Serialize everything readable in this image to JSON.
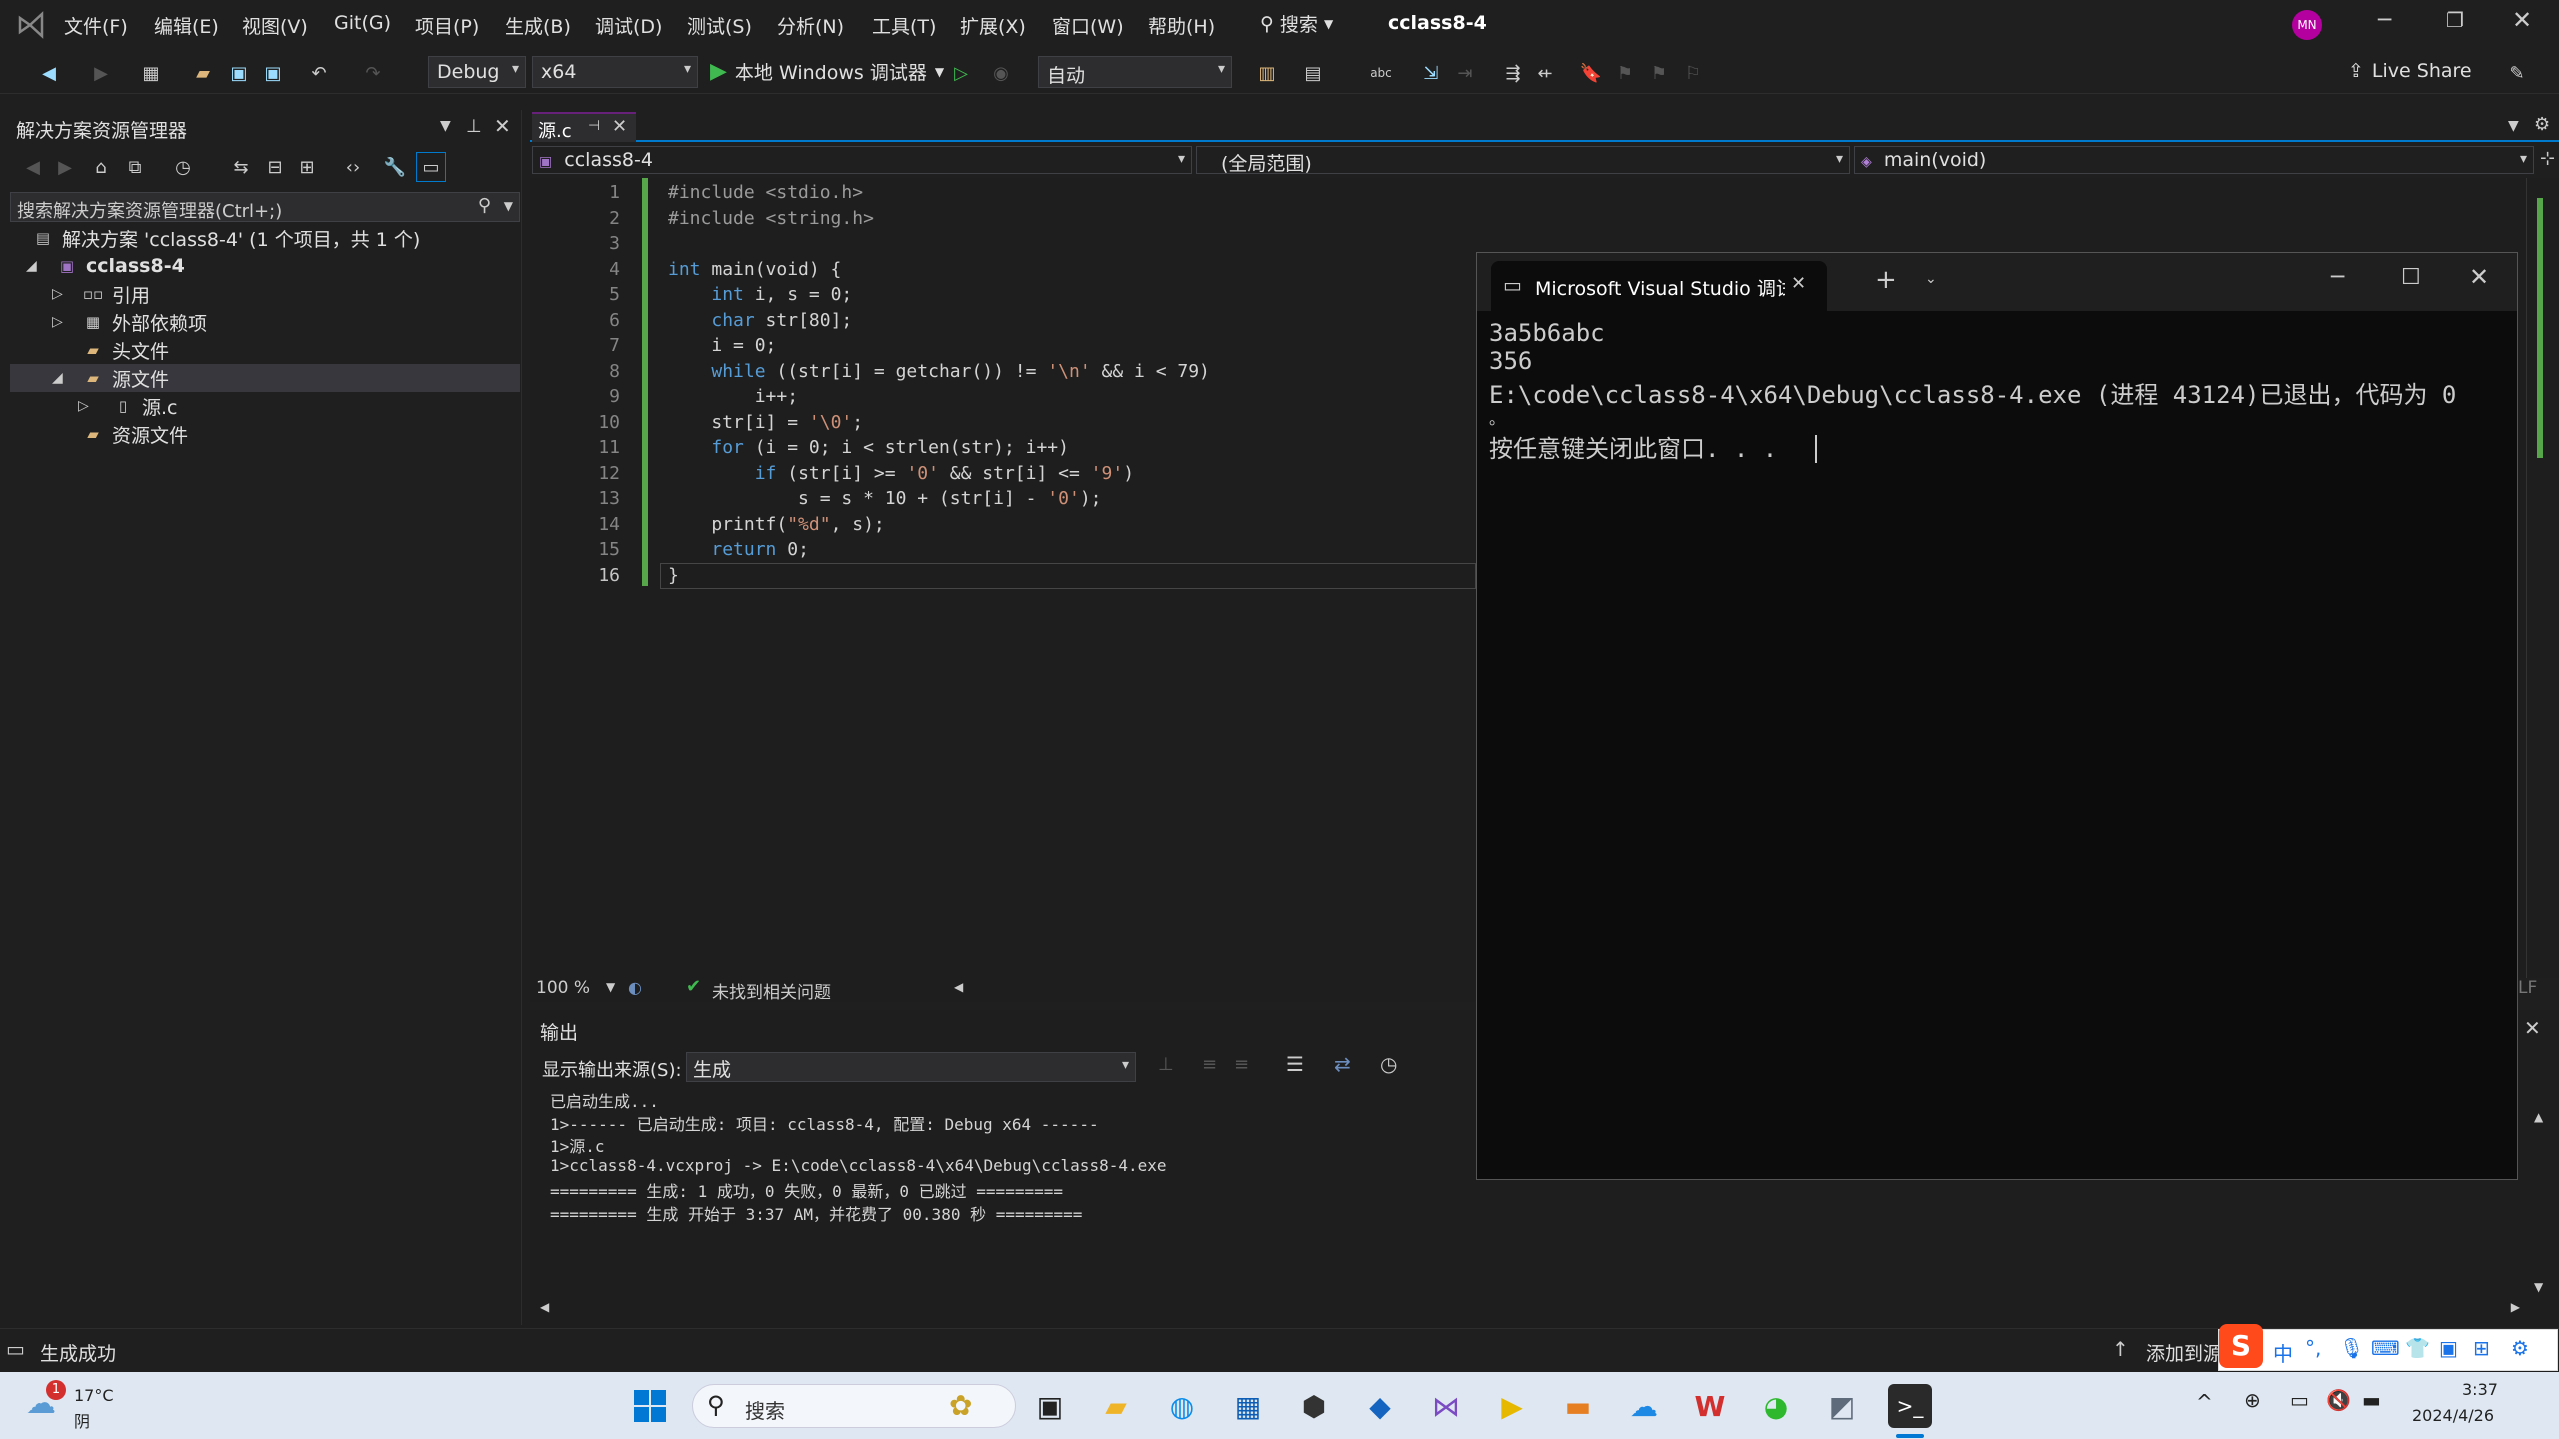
{
  "menu": {
    "items": [
      "文件(F)",
      "编辑(E)",
      "视图(V)",
      "Git(G)",
      "项目(P)",
      "生成(B)",
      "调试(D)",
      "测试(S)",
      "分析(N)",
      "工具(T)",
      "扩展(X)",
      "窗口(W)",
      "帮助(H)"
    ],
    "search_label": "搜索",
    "solution_title": "cclass8-4",
    "avatar_initials": "MN"
  },
  "toolbar": {
    "config": "Debug",
    "platform": "x64",
    "run_label": "本地 Windows 调试器",
    "auto_label": "自动",
    "live_share": "Live Share"
  },
  "solution_explorer": {
    "title": "解决方案资源管理器",
    "search_placeholder": "搜索解决方案资源管理器(Ctrl+;)",
    "tree": [
      {
        "label": "解决方案 'cclass8-4' (1 个项目，共 1 个)",
        "icon": "solution-icon"
      },
      {
        "label": "cclass8-4",
        "icon": "project-icon"
      },
      {
        "label": "引用",
        "icon": "references-icon"
      },
      {
        "label": "外部依赖项",
        "icon": "external-deps-icon"
      },
      {
        "label": "头文件",
        "icon": "folder-icon"
      },
      {
        "label": "源文件",
        "icon": "folder-icon"
      },
      {
        "label": "源.c",
        "icon": "c-file-icon"
      },
      {
        "label": "资源文件",
        "icon": "folder-icon"
      }
    ]
  },
  "editor": {
    "tab_label": "源.c",
    "nav_project": "cclass8-4",
    "nav_scope": "(全局范围)",
    "nav_function": "main(void)",
    "line_numbers": [
      "1",
      "2",
      "3",
      "4",
      "5",
      "6",
      "7",
      "8",
      "9",
      "10",
      "11",
      "12",
      "13",
      "14",
      "15",
      "16"
    ],
    "code": [
      "#include <stdio.h>",
      "#include <string.h>",
      "",
      "int main(void) {",
      "    int i, s = 0;",
      "    char str[80];",
      "    i = 0;",
      "    while ((str[i] = getchar()) != '\\n' && i < 79)",
      "        i++;",
      "    str[i] = '\\0';",
      "    for (i = 0; i < strlen(str); i++)",
      "        if (str[i] >= '0' && str[i] <= '9')",
      "            s = s * 10 + (str[i] - '0');",
      "    printf(\"%d\", s);",
      "    return 0;",
      "}"
    ],
    "zoom": "100 %",
    "issues": "未找到相关问题",
    "line_ending": "LF"
  },
  "console": {
    "title": "Microsoft Visual Studio 调试",
    "lines": [
      "3a5b6abc",
      "356",
      "E:\\code\\cclass8-4\\x64\\Debug\\cclass8-4.exe (进程 43124)已退出，代码为 0",
      "。",
      "按任意键关闭此窗口. . ."
    ]
  },
  "output": {
    "title": "输出",
    "source_label": "显示输出来源(S):",
    "source_value": "生成",
    "lines": [
      "已启动生成...",
      "1>------ 已启动生成: 项目: cclass8-4, 配置: Debug x64 ------",
      "1>源.c",
      "1>cclass8-4.vcxproj -> E:\\code\\cclass8-4\\x64\\Debug\\cclass8-4.exe",
      "========= 生成: 1 成功，0 失败，0 最新，0 已跳过 =========",
      "========= 生成 开始于 3:37 AM，并花费了 00.380 秒 ========="
    ]
  },
  "statusbar": {
    "status": "生成成功",
    "add_source": "添加到源"
  },
  "taskbar": {
    "weather_temp": "17°C",
    "weather_desc": "阴",
    "weather_badge": "1",
    "search_label": "搜索",
    "time": "3:37",
    "date": "2024/4/26",
    "ime_lang": "中"
  },
  "colors": {
    "accent": "#68217a",
    "editor_bg": "#1e1e1e",
    "keyword": "#569cd6",
    "string": "#ce9178",
    "change_bar": "#57a64a",
    "avatar": "#b4009e"
  }
}
